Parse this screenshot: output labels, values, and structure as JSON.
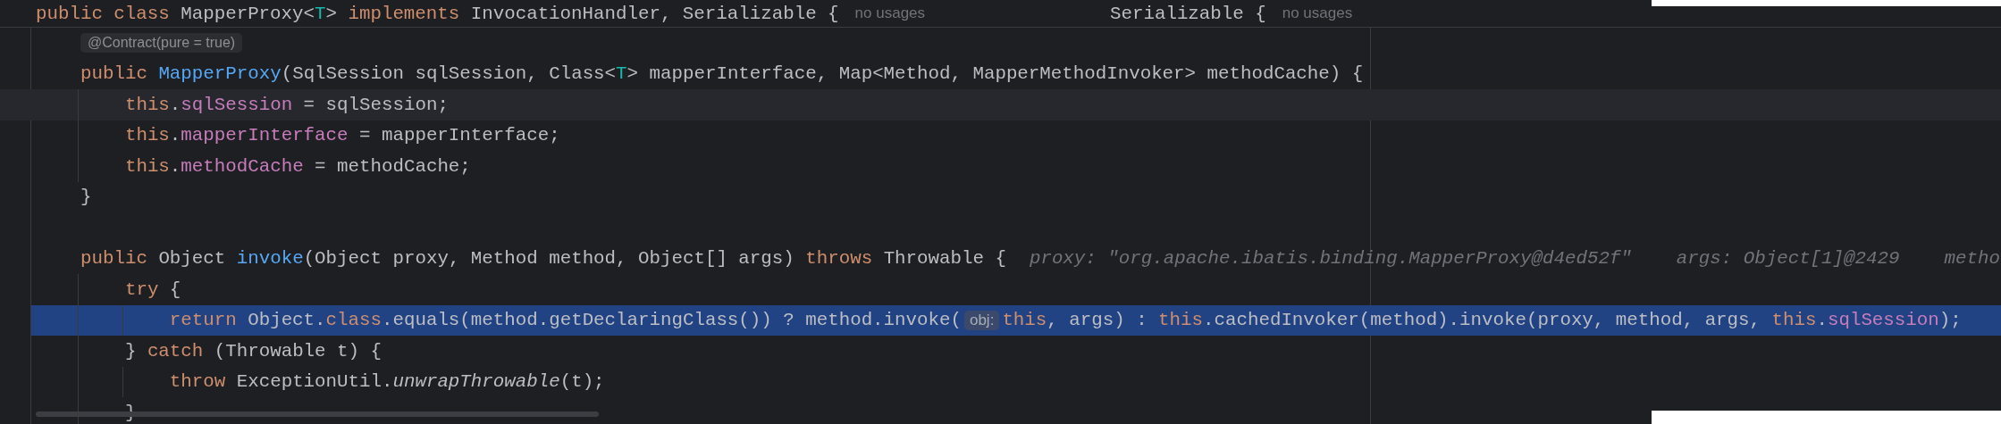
{
  "header": {
    "tokens": [
      {
        "t": "public class ",
        "kind": "keyword"
      },
      {
        "t": "MapperProxy<",
        "kind": "plain"
      },
      {
        "t": "T",
        "kind": "type_param"
      },
      {
        "t": ">",
        "kind": "plain"
      },
      {
        "t": " implements ",
        "kind": "keyword"
      },
      {
        "t": "InvocationHandler, Serializable {",
        "kind": "plain"
      }
    ],
    "usage_hint": "no usages"
  },
  "sticky_overlay": {
    "tokens": [
      {
        "t": "Serializable {",
        "kind": "plain"
      }
    ],
    "usage_hint": "no usages"
  },
  "lines": [
    {
      "current": false,
      "selected": false,
      "segments": [
        {
          "kind": "annotation_hint",
          "text": "@Contract(pure = true)"
        }
      ]
    },
    {
      "current": false,
      "selected": false,
      "segments": [
        {
          "kind": "code",
          "tokens": [
            {
              "t": "public ",
              "kind": "keyword"
            },
            {
              "t": "MapperProxy",
              "kind": "declaration"
            },
            {
              "t": "(SqlSession sqlSession, Class<",
              "kind": "plain"
            },
            {
              "t": "T",
              "kind": "type_param"
            },
            {
              "t": "> mapperInterface, Map<Method, MapperMethodInvoker> methodCache) {",
              "kind": "plain"
            }
          ]
        }
      ]
    },
    {
      "current": true,
      "selected": false,
      "segments": [
        {
          "kind": "code",
          "tokens": [
            {
              "t": "    this",
              "kind": "keyword"
            },
            {
              "t": ".",
              "kind": "plain"
            },
            {
              "t": "sqlSession",
              "kind": "field"
            },
            {
              "t": " = sqlSession;",
              "kind": "plain"
            }
          ]
        }
      ]
    },
    {
      "current": false,
      "selected": false,
      "segments": [
        {
          "kind": "code",
          "tokens": [
            {
              "t": "    this",
              "kind": "keyword"
            },
            {
              "t": ".",
              "kind": "plain"
            },
            {
              "t": "mapperInterface",
              "kind": "field"
            },
            {
              "t": " = mapperInterface;",
              "kind": "plain"
            }
          ]
        }
      ]
    },
    {
      "current": false,
      "selected": false,
      "segments": [
        {
          "kind": "code",
          "tokens": [
            {
              "t": "    this",
              "kind": "keyword"
            },
            {
              "t": ".",
              "kind": "plain"
            },
            {
              "t": "methodCache",
              "kind": "field"
            },
            {
              "t": " = methodCache;",
              "kind": "plain"
            }
          ]
        }
      ]
    },
    {
      "current": false,
      "selected": false,
      "segments": [
        {
          "kind": "code",
          "tokens": [
            {
              "t": "}",
              "kind": "plain"
            }
          ]
        }
      ]
    },
    {
      "current": false,
      "selected": false
    },
    {
      "current": false,
      "selected": false,
      "segments": [
        {
          "kind": "code",
          "tokens": [
            {
              "t": "public ",
              "kind": "keyword"
            },
            {
              "t": "Object ",
              "kind": "plain"
            },
            {
              "t": "invoke",
              "kind": "declaration"
            },
            {
              "t": "(Object proxy, Method method, Object[] args) ",
              "kind": "plain"
            },
            {
              "t": "throws ",
              "kind": "keyword"
            },
            {
              "t": "Throwable {",
              "kind": "plain"
            }
          ]
        },
        {
          "kind": "debug_value",
          "text": "proxy: \"org.apache.ibatis.binding.MapperProxy@d4ed52f\""
        },
        {
          "kind": "debug_value",
          "text": "args: Object[1]@2429"
        },
        {
          "kind": "debug_value",
          "text": "metho"
        }
      ]
    },
    {
      "current": false,
      "selected": false,
      "segments": [
        {
          "kind": "code",
          "tokens": [
            {
              "t": "    try ",
              "kind": "keyword"
            },
            {
              "t": "{",
              "kind": "plain"
            }
          ]
        }
      ]
    },
    {
      "current": false,
      "selected": true,
      "segments": [
        {
          "kind": "code",
          "tokens": [
            {
              "t": "        return ",
              "kind": "keyword"
            },
            {
              "t": "Object.",
              "kind": "plain"
            },
            {
              "t": "class",
              "kind": "keyword"
            },
            {
              "t": ".equals(method.getDeclaringClass()) ? method.invoke(",
              "kind": "plain"
            }
          ]
        },
        {
          "kind": "param_hint",
          "text": "obj:"
        },
        {
          "kind": "code",
          "tokens": [
            {
              "t": "this",
              "kind": "keyword"
            },
            {
              "t": ", args) : ",
              "kind": "plain"
            },
            {
              "t": "this",
              "kind": "keyword"
            },
            {
              "t": ".cachedInvoker(method).invoke(proxy, method, args, ",
              "kind": "plain"
            },
            {
              "t": "this",
              "kind": "keyword"
            },
            {
              "t": ".",
              "kind": "plain"
            },
            {
              "t": "sqlSession",
              "kind": "field"
            },
            {
              "t": ");",
              "kind": "plain"
            }
          ]
        }
      ]
    },
    {
      "current": false,
      "selected": false,
      "segments": [
        {
          "kind": "code",
          "tokens": [
            {
              "t": "    } ",
              "kind": "plain"
            },
            {
              "t": "catch ",
              "kind": "keyword"
            },
            {
              "t": "(Throwable t) {",
              "kind": "plain"
            }
          ]
        }
      ]
    },
    {
      "current": false,
      "selected": false,
      "segments": [
        {
          "kind": "code",
          "tokens": [
            {
              "t": "        throw ",
              "kind": "keyword"
            },
            {
              "t": "ExceptionUtil.",
              "kind": "plain"
            },
            {
              "t": "unwrapThrowable",
              "kind": "static_call"
            },
            {
              "t": "(t);",
              "kind": "plain"
            }
          ]
        }
      ]
    },
    {
      "current": false,
      "selected": false,
      "segments": [
        {
          "kind": "code",
          "tokens": [
            {
              "t": "    }",
              "kind": "plain"
            }
          ]
        }
      ]
    }
  ]
}
